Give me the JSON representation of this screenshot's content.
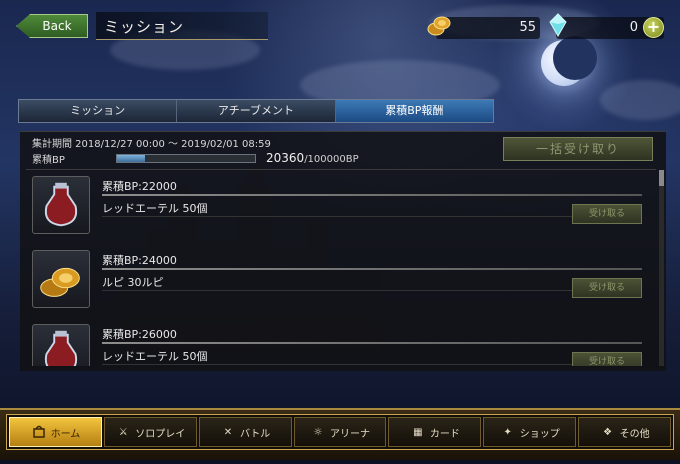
{
  "header": {
    "back_label": "Back",
    "title": "ミッション",
    "gold_value": "55",
    "gem_value": "0",
    "plus_label": "+"
  },
  "tabs": [
    {
      "label": "ミッション",
      "active": false
    },
    {
      "label": "アチーブメント",
      "active": false
    },
    {
      "label": "累積BP報酬",
      "active": true
    }
  ],
  "summary": {
    "period": "集計期間 2018/12/27 00:00 〜 2019/02/01 08:59",
    "bp_label": "累積BP",
    "bp_current": "20360",
    "bp_max": "/100000BP",
    "bp_progress": 0.2036,
    "bulk_button": "一括受け取り"
  },
  "rewards": [
    {
      "title": "累積BP:22000",
      "desc": "レッドエーテル 50個",
      "button": "受け取る",
      "icon": "red-ether-icon"
    },
    {
      "title": "累積BP:24000",
      "desc": "ルピ 30ルピ",
      "button": "受け取る",
      "icon": "rupie-coins-icon"
    },
    {
      "title": "累積BP:26000",
      "desc": "レッドエーテル 50個",
      "button": "受け取る",
      "icon": "red-ether-icon"
    }
  ],
  "nav": [
    {
      "label": "ホーム",
      "icon": "home-icon",
      "active": true
    },
    {
      "label": "ソロプレイ",
      "icon": "sword-icon",
      "active": false
    },
    {
      "label": "バトル",
      "icon": "crossed-swords-icon",
      "active": false
    },
    {
      "label": "アリーナ",
      "icon": "arena-icon",
      "active": false
    },
    {
      "label": "カード",
      "icon": "cards-icon",
      "active": false
    },
    {
      "label": "ショップ",
      "icon": "shop-icon",
      "active": false
    },
    {
      "label": "その他",
      "icon": "other-icon",
      "active": false
    }
  ],
  "colors": {
    "accent_blue": "#1c4a84",
    "nav_active": "#f2c43e",
    "back_green": "#4f8a3a"
  }
}
